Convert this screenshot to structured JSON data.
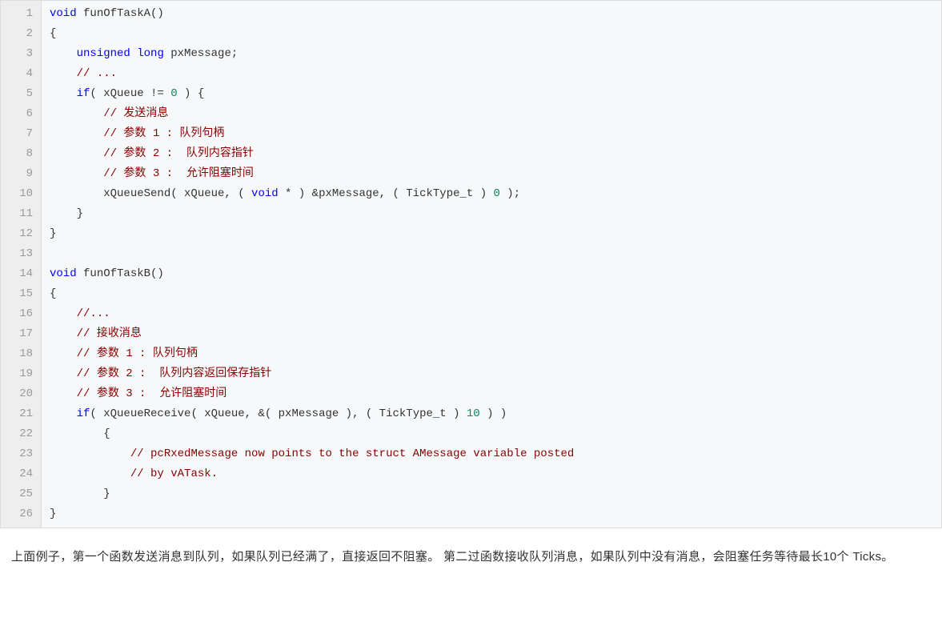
{
  "code": {
    "lineCount": 26,
    "lines": [
      [
        {
          "t": "void",
          "c": "kw"
        },
        {
          "t": " "
        },
        {
          "t": "funOfTaskA"
        },
        {
          "t": "()"
        }
      ],
      [
        {
          "t": "{"
        }
      ],
      [
        {
          "t": "    "
        },
        {
          "t": "unsigned",
          "c": "kw"
        },
        {
          "t": " "
        },
        {
          "t": "long",
          "c": "kw"
        },
        {
          "t": " pxMessage;"
        }
      ],
      [
        {
          "t": "    "
        },
        {
          "t": "// ...",
          "c": "cm"
        }
      ],
      [
        {
          "t": "    "
        },
        {
          "t": "if",
          "c": "kw"
        },
        {
          "t": "( xQueue != "
        },
        {
          "t": "0",
          "c": "num"
        },
        {
          "t": " ) {"
        }
      ],
      [
        {
          "t": "        "
        },
        {
          "t": "// 发送消息",
          "c": "cm"
        }
      ],
      [
        {
          "t": "        "
        },
        {
          "t": "// 参数 1 : 队列句柄",
          "c": "cm"
        }
      ],
      [
        {
          "t": "        "
        },
        {
          "t": "// 参数 2 :  队列内容指针",
          "c": "cm"
        }
      ],
      [
        {
          "t": "        "
        },
        {
          "t": "// 参数 3 :  允许阻塞时间",
          "c": "cm"
        }
      ],
      [
        {
          "t": "        xQueueSend( xQueue, ( "
        },
        {
          "t": "void",
          "c": "kw"
        },
        {
          "t": " * ) &pxMessage, ( TickType_t ) "
        },
        {
          "t": "0",
          "c": "num"
        },
        {
          "t": " );"
        }
      ],
      [
        {
          "t": "    }"
        }
      ],
      [
        {
          "t": "}"
        }
      ],
      [
        {
          "t": ""
        }
      ],
      [
        {
          "t": "void",
          "c": "kw"
        },
        {
          "t": " "
        },
        {
          "t": "funOfTaskB"
        },
        {
          "t": "()"
        }
      ],
      [
        {
          "t": "{"
        }
      ],
      [
        {
          "t": "    "
        },
        {
          "t": "//...",
          "c": "cm"
        }
      ],
      [
        {
          "t": "    "
        },
        {
          "t": "// 接收消息",
          "c": "cm"
        }
      ],
      [
        {
          "t": "    "
        },
        {
          "t": "// 参数 1 : 队列句柄",
          "c": "cm"
        }
      ],
      [
        {
          "t": "    "
        },
        {
          "t": "// 参数 2 :  队列内容返回保存指针",
          "c": "cm"
        }
      ],
      [
        {
          "t": "    "
        },
        {
          "t": "// 参数 3 :  允许阻塞时间",
          "c": "cm"
        }
      ],
      [
        {
          "t": "    "
        },
        {
          "t": "if",
          "c": "kw"
        },
        {
          "t": "( xQueueReceive( xQueue, &( pxMessage ), ( TickType_t ) "
        },
        {
          "t": "10",
          "c": "num"
        },
        {
          "t": " ) )"
        }
      ],
      [
        {
          "t": "        {"
        }
      ],
      [
        {
          "t": "            "
        },
        {
          "t": "// pcRxedMessage now points to the struct AMessage variable posted",
          "c": "cm"
        }
      ],
      [
        {
          "t": "            "
        },
        {
          "t": "// by vATask.",
          "c": "cm"
        }
      ],
      [
        {
          "t": "        }"
        }
      ],
      [
        {
          "t": "}"
        }
      ]
    ]
  },
  "paragraph": "上面例子，第一个函数发送消息到队列，如果队列已经满了，直接返回不阻塞。 第二过函数接收队列消息，如果队列中没有消息，会阻塞任务等待最长10个 Ticks。"
}
